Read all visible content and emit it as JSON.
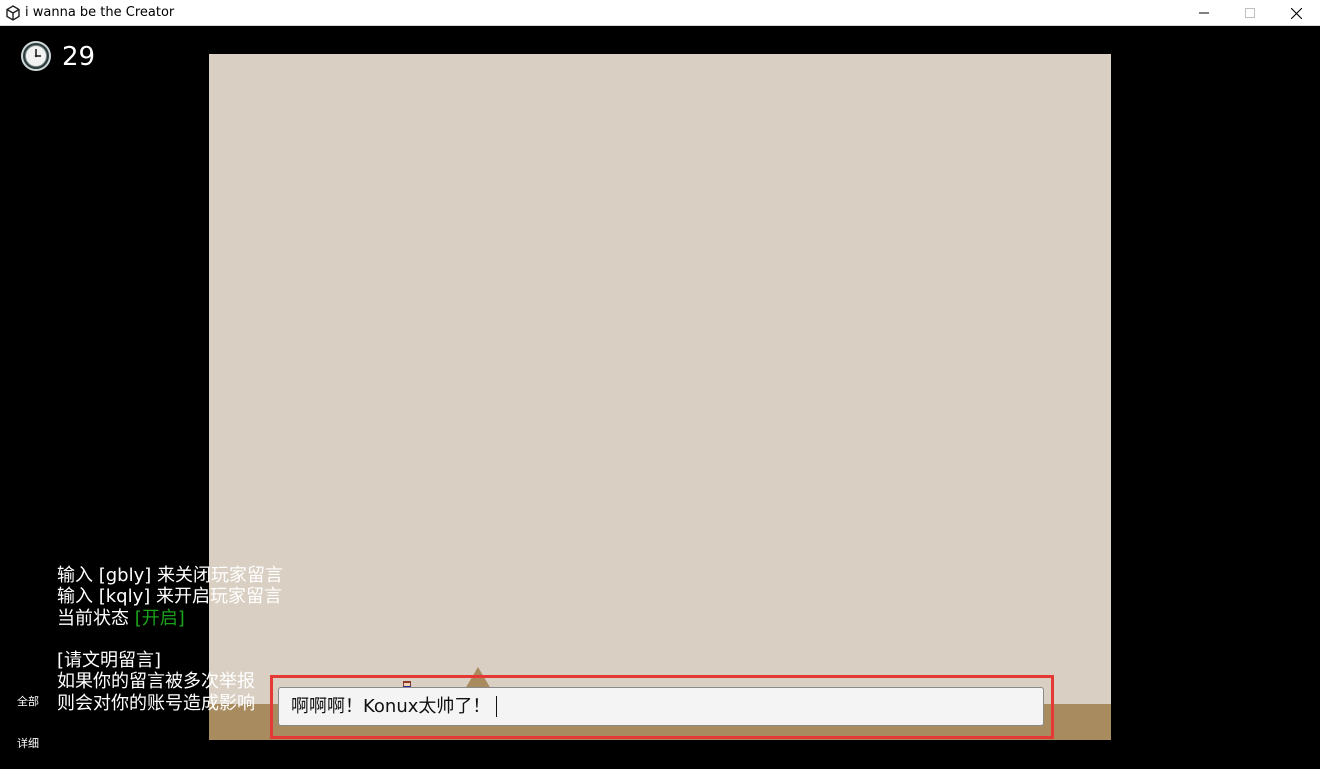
{
  "window": {
    "title": "i wanna be the Creator",
    "controls": [
      "minimize",
      "maximize",
      "close"
    ]
  },
  "hud": {
    "clock_icon": "clock-icon",
    "timer": "29"
  },
  "chat_info": {
    "line1": "输入 [gbly] 来关闭玩家留言",
    "line2": "输入 [kqly] 来开启玩家留言",
    "line3_prefix": "当前状态 ",
    "line3_status": "[开启]",
    "line4": "[请文明留言]",
    "line5": "如果你的留言被多次举报",
    "line6": "则会对你的账号造成影响"
  },
  "side_tabs": {
    "all": "全部",
    "detail": "详细"
  },
  "input": {
    "value": "啊啊啊！Konux太帅了！"
  },
  "colors": {
    "background": "#000000",
    "viewport": "#d9cfc2",
    "ground": "#a88b5e",
    "status_on": "#1aa31a",
    "highlight": "#e53935"
  }
}
